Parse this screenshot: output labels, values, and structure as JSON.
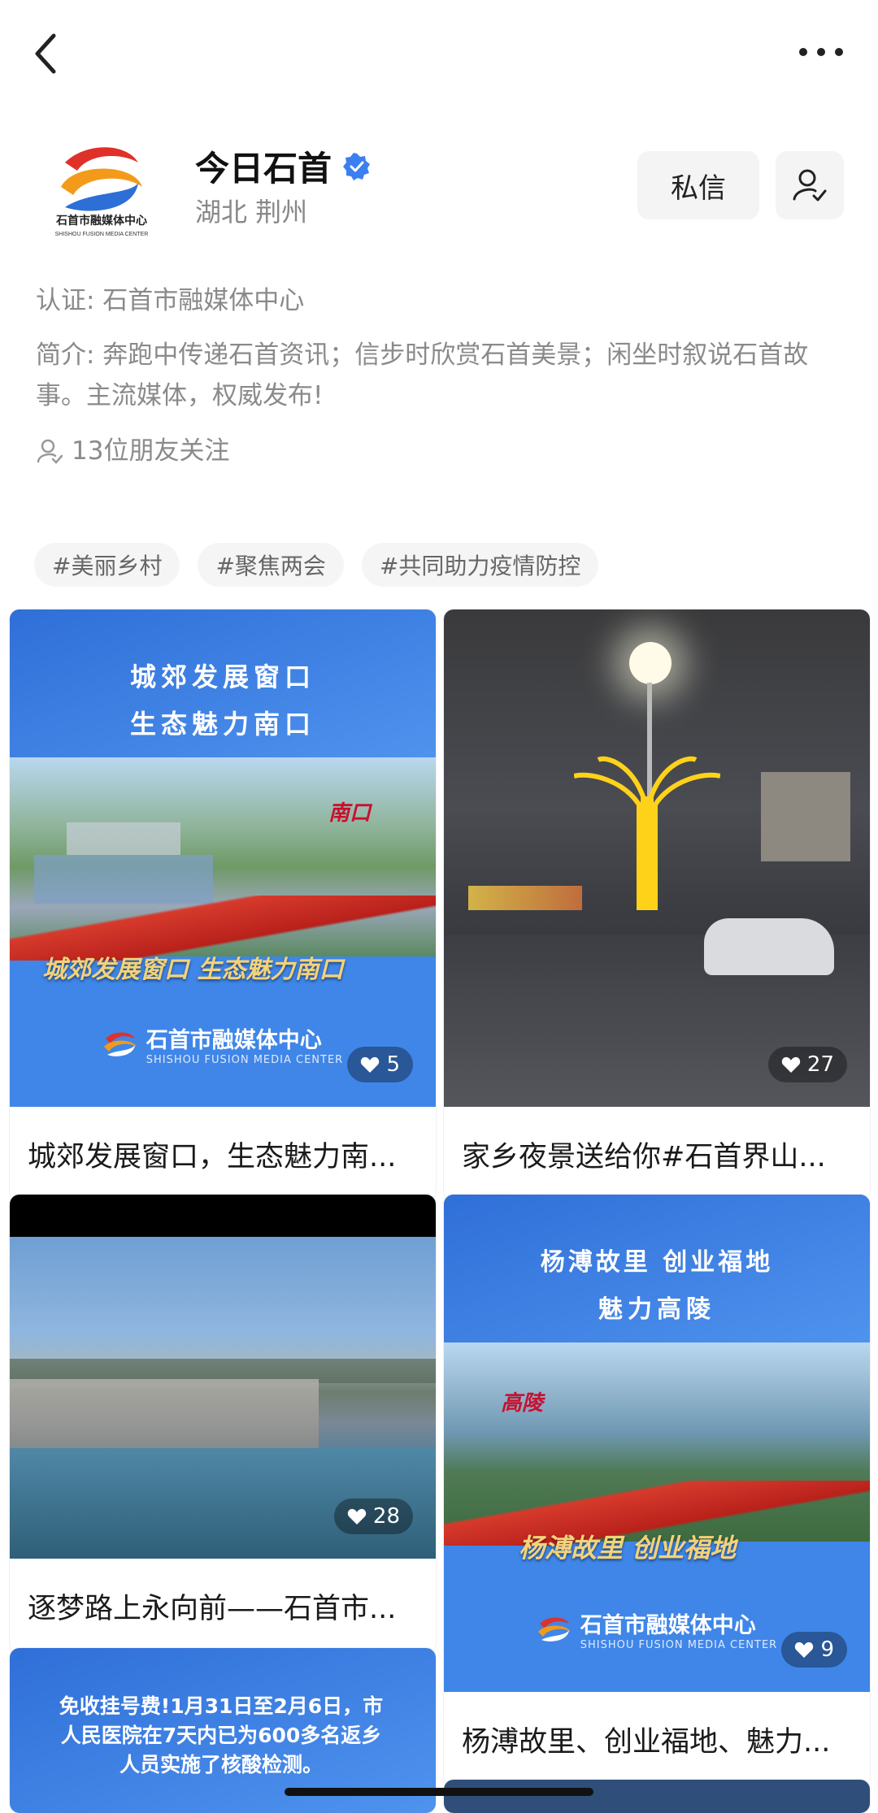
{
  "profile": {
    "name": "今日石首",
    "location": "湖北 荆州",
    "logo_line1": "石首市融媒体中心",
    "logo_line2": "SHISHOU FUSION MEDIA CENTER",
    "message_button": "私信",
    "certification": "认证: 石首市融媒体中心",
    "bio": "简介: 奔跑中传递石首资讯；信步时欣赏石首美景；闲坐时叙说石首故事。主流媒体，权威发布!",
    "friends_following": "13位朋友关注"
  },
  "tags": [
    "#美丽乡村",
    "#聚焦两会",
    "#共同助力疫情防控"
  ],
  "posts": [
    {
      "banner_line1": "城郊发展窗口",
      "banner_line2": "生态魅力南口",
      "place_label": "南口",
      "caption_overlay": "城郊发展窗口 生态魅力南口",
      "brand": "石首市融媒体中心",
      "brand_sub": "SHISHOU FUSION MEDIA CENTER",
      "likes": "5",
      "title": "城郊发展窗口，生态魅力南..."
    },
    {
      "likes": "27",
      "title": "家乡夜景送给你#石首界山..."
    },
    {
      "likes": "28",
      "title": "逐梦路上永向前——石首市..."
    },
    {
      "banner_line1": "杨溥故里  创业福地",
      "banner_line2": "魅力高陵",
      "place_label": "高陵",
      "caption_overlay": "杨溥故里 创业福地",
      "brand": "石首市融媒体中心",
      "brand_sub": "SHISHOU FUSION MEDIA CENTER",
      "likes": "9",
      "title": "杨溥故里、创业福地、魅力..."
    },
    {
      "banner_text": "免收挂号费!1月31日至2月6日，市人民医院在7天内已为600多名返乡人员实施了核酸检测。"
    }
  ],
  "colors": {
    "accent_blue": "#3f86e8",
    "verified_blue": "#3b7ff0",
    "gold_text": "#f3d27a"
  }
}
